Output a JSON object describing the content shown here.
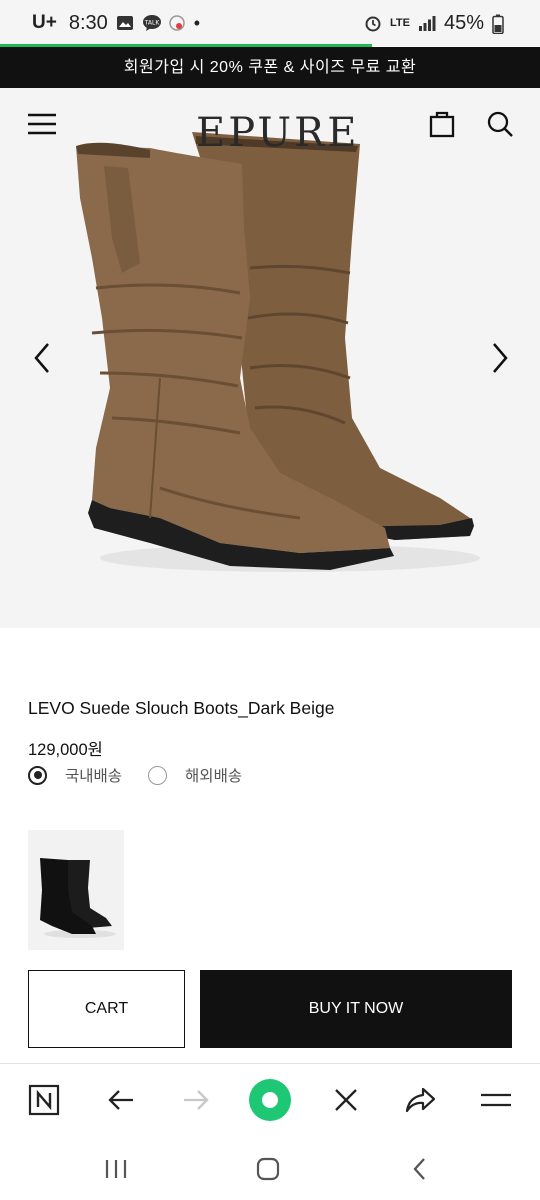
{
  "status_bar": {
    "carrier": "U+",
    "time": "8:30",
    "network": "LTE",
    "battery": "45%"
  },
  "promo": {
    "text": "회원가입 시 20% 쿠폰 & 사이즈 무료 교환"
  },
  "header": {
    "logo": "EPURE",
    "icons": [
      "menu-icon",
      "bag-icon",
      "search-icon"
    ]
  },
  "product": {
    "name": "LEVO Suede Slouch Boots_Dark Beige",
    "price": "129,000원",
    "shipping_options": [
      {
        "label": "국내배송",
        "selected": true
      },
      {
        "label": "해외배송",
        "selected": false
      }
    ],
    "colors": {
      "boot": "#8a6a4a",
      "sole": "#1e1e1e"
    }
  },
  "actions": {
    "cart_label": "CART",
    "buy_label": "BUY IT NOW"
  },
  "browser_toolbar": {
    "icons": [
      "naver-icon",
      "back-icon",
      "forward-icon",
      "green-dot-icon",
      "close-icon",
      "share-icon",
      "menu-icon"
    ],
    "accent": "#1ec773"
  },
  "nav_bar": {
    "icons": [
      "recents-icon",
      "home-icon",
      "back-icon"
    ]
  }
}
